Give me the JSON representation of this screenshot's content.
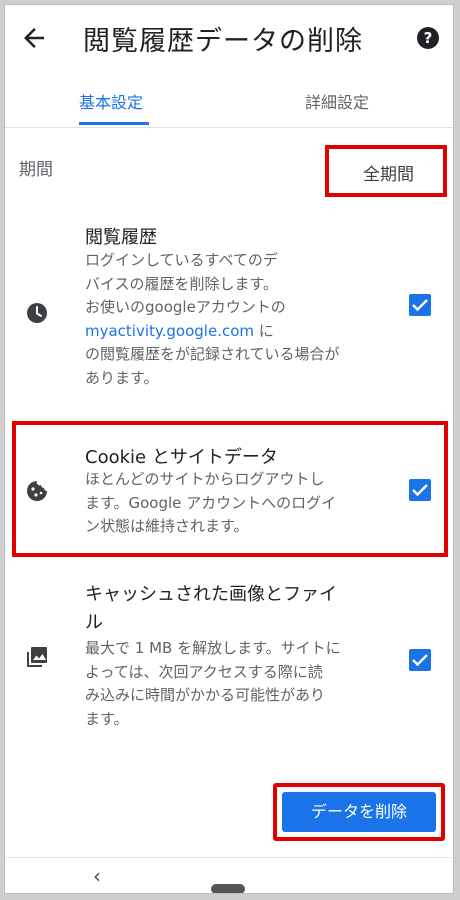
{
  "header": {
    "title": "閲覧履歴データの削除",
    "back_icon": "arrow-left-icon",
    "help_icon": "help-circle-icon",
    "help_glyph": "?"
  },
  "tabs": [
    {
      "label": "基本設定",
      "active": true
    },
    {
      "label": "詳細設定",
      "active": false
    }
  ],
  "period": {
    "label": "期間",
    "selected": "全期間"
  },
  "items": [
    {
      "icon": "clock-icon",
      "title": "閲覧履歴",
      "desc_lines": [
        "ログインしているすべてのデ",
        "バイスの履歴を削除します。",
        "お使いのgoogleアカウントの"
      ],
      "desc_link": "myactivity.google.com",
      "desc_after_link": " に",
      "desc_lines_after": [
        "の閲覧履歴をが記録されている場合が",
        "あります。"
      ],
      "checked": true
    },
    {
      "icon": "cookie-icon",
      "title": "Cookie とサイトデータ",
      "desc_lines": [
        "ほとんどのサイトからログアウトし",
        "ます。Google アカウントへのログイ",
        "ン状態は維持されます。"
      ],
      "checked": true
    },
    {
      "icon": "image-icon",
      "title_lines": [
        "キャッシュされた画像とファイ",
        "ル"
      ],
      "desc_lines": [
        "最大で 1 MB を解放します。サイトに",
        "よっては、次回アクセスする際に読",
        "み込みに時間がかかる可能性があり",
        "ます。"
      ],
      "checked": true
    }
  ],
  "actions": {
    "delete_label": "データを削除"
  },
  "navbar": {
    "back_glyph": "‹"
  },
  "colors": {
    "accent": "#1a73e8",
    "highlight": "#e00000"
  }
}
